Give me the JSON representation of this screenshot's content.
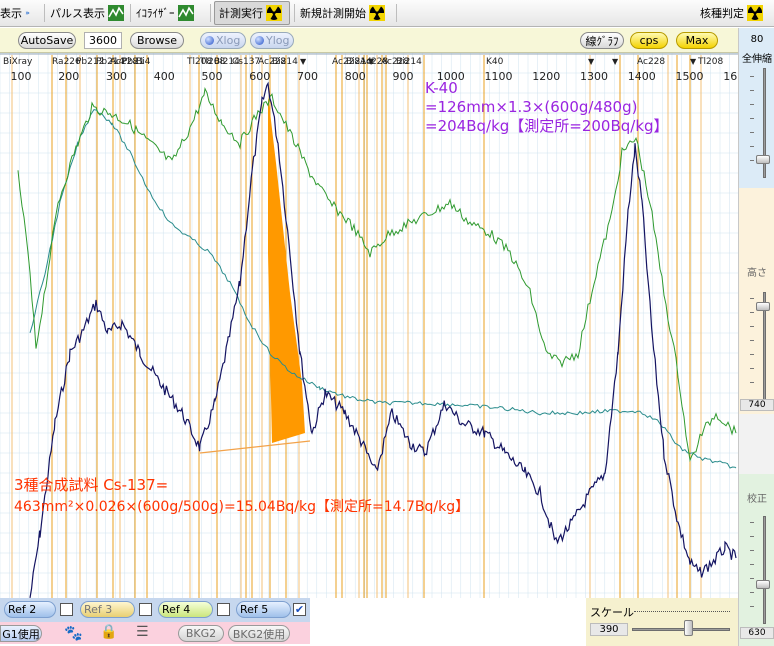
{
  "toolbar": {
    "items": [
      {
        "label": "表示",
        "icon": "chevron-icon"
      },
      {
        "label": "パルス表示",
        "icon": "wave-chart-icon"
      },
      {
        "label": "ｲｺﾗｲｻﾞｰ",
        "icon": "wave-chart-icon"
      },
      {
        "label": "計測実行",
        "icon": "radiation-icon"
      },
      {
        "label": "新規計測開始",
        "icon": "radiation-icon"
      },
      {
        "label": "核種判定",
        "icon": "radiation-icon"
      }
    ]
  },
  "toolbar2": {
    "autosave_label": "AutoSave",
    "seconds_value": "3600",
    "browse_label": "Browse",
    "xlog_label": "Xlog",
    "ylog_label": "Ylog",
    "line_graph_label": "線ｸﾞﾗﾌ",
    "cps_label": "cps",
    "max_label": "Max"
  },
  "right_panel": {
    "top_value": "80",
    "zoom_label": "全伸縮",
    "height_label": "高さ",
    "height_value": "740",
    "calib_label": "校正",
    "calib_value": "630"
  },
  "chart": {
    "x_ticks": [
      "100",
      "200",
      "300",
      "400",
      "500",
      "600",
      "700",
      "800",
      "900",
      "1000",
      "1100",
      "1200",
      "1300",
      "1400",
      "1500",
      "1600"
    ],
    "nuclide_labels": [
      "BiXray",
      "Ra226",
      "Pb212",
      "Pb214",
      "Ac228",
      "Pb214",
      "Bi",
      "Tl208",
      "Tl208",
      "Bi214",
      "Cs137",
      "Ac228",
      "Bi214",
      "Ac228",
      "Bi214",
      "Ac228",
      "Ac228",
      "Bi214",
      "K40",
      "Ac228",
      "Tl208"
    ],
    "annotation_k40": {
      "line1": "K-40",
      "line2": "=126mm×1.3×(600g/480g)",
      "line3": "=204Bq/kg【測定所=200Bq/kg】"
    },
    "annotation_cs137": {
      "line1": "3種合成試料  Cs-137=",
      "line2": "463mm²×0.026×(600g/500g)=15.04Bq/kg【測定所=14.7Bq/kg】"
    },
    "colors": {
      "navy": "#141462",
      "green": "#2f9a2f",
      "teal": "#2a8c8c",
      "orange_fill": "#ff9900",
      "marker": "#e8a020",
      "annotation_purple": "#9a24e0",
      "annotation_red": "#ff3300"
    }
  },
  "bottom": {
    "refs": [
      {
        "label": "Ref 2",
        "checked": false
      },
      {
        "label": "Ref 3",
        "checked": false
      },
      {
        "label": "Ref 4",
        "checked": false
      },
      {
        "label": "Ref 5",
        "checked": true
      }
    ],
    "bg1_label": "G1使用",
    "bkg2_label": "BKG2",
    "bkg2_use_label": "BKG2使用",
    "scale_label": "スケール",
    "scale_value": "390"
  }
}
